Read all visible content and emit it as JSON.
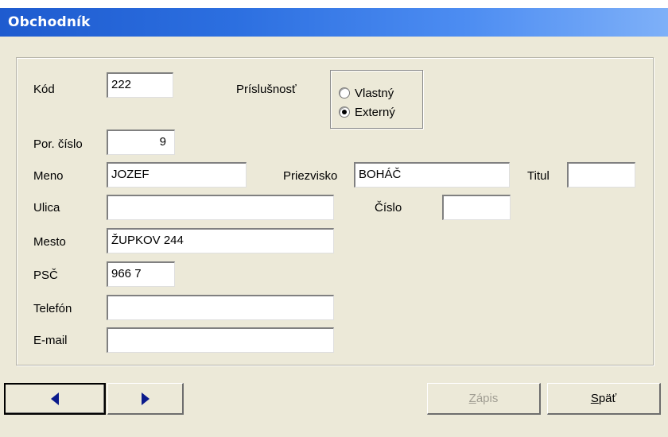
{
  "window": {
    "title": "Obchodník"
  },
  "form": {
    "kod": {
      "label": "Kód",
      "value": "222"
    },
    "prislusnost": {
      "label": "Príslušnosť",
      "options": [
        "Vlastný",
        "Externý"
      ],
      "selected": "Externý"
    },
    "por_cislo": {
      "label": "Por. číslo",
      "value": "9"
    },
    "meno": {
      "label": "Meno",
      "value": "JOZEF"
    },
    "priezvisko": {
      "label": "Priezvisko",
      "value": "BOHÁČ"
    },
    "titul": {
      "label": "Titul",
      "value": ""
    },
    "ulica": {
      "label": "Ulica",
      "value": ""
    },
    "cislo": {
      "label": "Číslo",
      "value": ""
    },
    "mesto": {
      "label": "Mesto",
      "value": "ŽUPKOV 244"
    },
    "psc": {
      "label": "PSČ",
      "value": "966 7"
    },
    "telefon": {
      "label": "Telefón",
      "value": ""
    },
    "email": {
      "label": "E-mail",
      "value": ""
    }
  },
  "buttons": {
    "prev_icon": "left-arrow-icon",
    "next_icon": "right-arrow-icon",
    "zapis": {
      "mnemonic": "Z",
      "rest": "ápis",
      "enabled": false
    },
    "spat": {
      "mnemonic": "S",
      "rest": "päť",
      "enabled": true
    }
  },
  "colors": {
    "titlebar_start": "#1e5bcf",
    "titlebar_end": "#7eb0f8",
    "face": "#ece9d8",
    "arrow": "#0a1a8c"
  }
}
